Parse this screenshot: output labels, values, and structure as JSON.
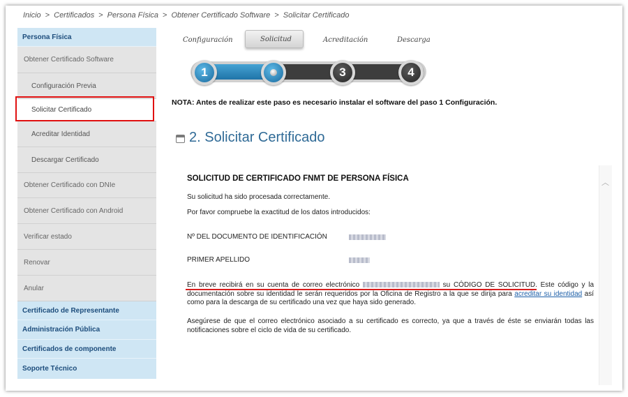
{
  "breadcrumb": {
    "items": [
      "Inicio",
      "Certificados",
      "Persona Física",
      "Obtener Certificado Software",
      "Solicitar Certificado"
    ],
    "separator": ">"
  },
  "sidebar": {
    "items": [
      {
        "label": "Persona Física",
        "kind": "section-header"
      },
      {
        "label": "Obtener Certificado Software",
        "kind": "main"
      },
      {
        "label": "Configuración Previa",
        "kind": "sub"
      },
      {
        "label": "Solicitar Certificado",
        "kind": "sub",
        "active": true
      },
      {
        "label": "Acreditar Identidad",
        "kind": "sub"
      },
      {
        "label": "Descargar Certificado",
        "kind": "sub"
      },
      {
        "label": "Obtener Certificado con DNIe",
        "kind": "main"
      },
      {
        "label": "Obtener Certificado con Android",
        "kind": "main"
      },
      {
        "label": "Verificar estado",
        "kind": "main"
      },
      {
        "label": "Renovar",
        "kind": "main"
      },
      {
        "label": "Anular",
        "kind": "main"
      },
      {
        "label": "Certificado de Representante",
        "kind": "section-header"
      },
      {
        "label": "Administración Pública",
        "kind": "section-header"
      },
      {
        "label": "Certificados de componente",
        "kind": "section-header"
      },
      {
        "label": "Soporte Técnico",
        "kind": "section-header"
      }
    ]
  },
  "stepper": {
    "steps": [
      {
        "label": "Configuración",
        "number": "1",
        "state": "done"
      },
      {
        "label": "Solicitud",
        "number": "2",
        "state": "current"
      },
      {
        "label": "Acreditación",
        "number": "3",
        "state": "todo"
      },
      {
        "label": "Descarga",
        "number": "4",
        "state": "todo"
      }
    ],
    "progress_fraction": 0.4
  },
  "nota": "NOTA: Antes de realizar este paso es necesario instalar el software del paso 1 Configuración.",
  "page_title": "2. Solicitar Certificado",
  "content": {
    "heading": "SOLICITUD DE CERTIFICADO FNMT DE PERSONA FÍSICA",
    "processed": "Su solicitud ha sido procesada correctamente.",
    "verify": "Por favor compruebe la exactitud de los datos introducidos:",
    "field_doc_label": "Nº DEL DOCUMENTO DE IDENTIFICACIÓN",
    "field_surname_label": "PRIMER APELLIDO",
    "email_para_before": "En breve recibirá en su cuenta de correo electrónico",
    "email_para_middle": "su CÓDIGO DE SOLICITUD. Este código y la documentación sobre su identidad le serán requeridos por la Oficina de Registro a la que se dirija para",
    "email_para_link": "acreditar su identidad",
    "email_para_after": "así como para la descarga de su certificado una vez que haya sido generado.",
    "warning_para": "Asegúrese de que el correo electrónico asociado a su certificado es correcto, ya que a través de éste se enviarán todas las notificaciones sobre el ciclo de vida de su certificado."
  },
  "colors": {
    "accent": "#2f6a96",
    "sidebar_header_bg": "#cfe6f4",
    "highlight_border": "#e01010",
    "underline": "#d81e1e"
  }
}
